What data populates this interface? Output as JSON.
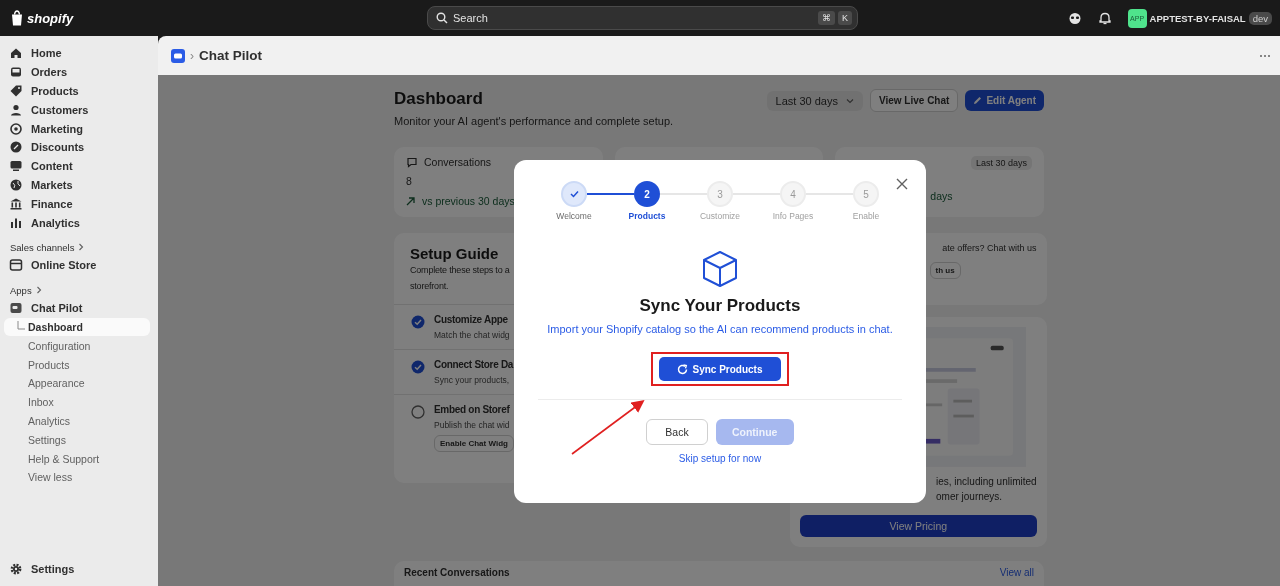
{
  "topbar": {
    "logo": "shopify",
    "search": {
      "placeholder": "Search",
      "keys": [
        "⌘",
        "K"
      ]
    },
    "store": {
      "avatar": "APP",
      "name": "APPTEST-BY-FAISAL",
      "badge": "dev"
    }
  },
  "sidebar": {
    "nav": [
      {
        "label": "Home",
        "selected": false
      },
      {
        "label": "Orders",
        "selected": false
      },
      {
        "label": "Products",
        "selected": false
      },
      {
        "label": "Customers",
        "selected": false
      },
      {
        "label": "Marketing",
        "selected": false
      },
      {
        "label": "Discounts",
        "selected": false
      },
      {
        "label": "Content",
        "selected": false
      },
      {
        "label": "Markets",
        "selected": false
      },
      {
        "label": "Finance",
        "selected": false
      },
      {
        "label": "Analytics",
        "selected": false
      }
    ],
    "sales_channels": {
      "heading": "Sales channels",
      "items": [
        {
          "label": "Online Store",
          "selected": false
        }
      ]
    },
    "apps": {
      "heading": "Apps",
      "items": [
        {
          "label": "Chat Pilot",
          "selected": false,
          "children": [
            {
              "label": "Dashboard",
              "selected": true
            },
            {
              "label": "Configuration",
              "selected": false
            },
            {
              "label": "Products",
              "selected": false
            },
            {
              "label": "Appearance",
              "selected": false
            },
            {
              "label": "Inbox",
              "selected": false
            },
            {
              "label": "Analytics",
              "selected": false
            },
            {
              "label": "Settings",
              "selected": false
            },
            {
              "label": "Help & Support",
              "selected": false
            },
            {
              "label": "View less",
              "selected": false
            }
          ]
        }
      ]
    },
    "footer": {
      "label": "Settings"
    }
  },
  "page_header": {
    "separator": "›",
    "breadcrumb": "Chat Pilot"
  },
  "dashboard": {
    "title": "Dashboard",
    "subtitle": "Monitor your AI agent's performance and complete setup.",
    "period": "Last 30 days",
    "buttons": [
      {
        "label": "View Live Chat",
        "kind": "secondary"
      },
      {
        "label": "Edit Agent",
        "kind": "primary"
      }
    ]
  },
  "stat_cards": [
    {
      "kind": "stat",
      "label": "Conversations",
      "value": "8",
      "trend": "vs previous 30 days"
    },
    {
      "kind": "stat"
    },
    {
      "kind": "stat",
      "period": "Last 30 days",
      "trend": "days"
    }
  ],
  "setup_guide": {
    "title": "Setup Guide",
    "description": [
      "Complete these steps to a",
      "storefront."
    ],
    "steps": [
      {
        "title": "Customize Appe",
        "text": "Match the chat widg",
        "done": true
      },
      {
        "title": "Connect Store Da",
        "text": "Sync your products,",
        "done": true
      },
      {
        "title": "Embed on Storef",
        "text": "Publish the chat wid",
        "done": false,
        "button": "Enable Chat Widg"
      }
    ]
  },
  "promo": {
    "text": "ate offers? Chat with us",
    "button": "th us"
  },
  "pricing": {
    "image": {
      "kind": "picture"
    },
    "lines": [
      "ies, including unlimited",
      "omer journeys."
    ],
    "button": "View Pricing"
  },
  "recent": {
    "title": "Recent Conversations",
    "link": "View all"
  },
  "modal": {
    "steps": [
      {
        "label": "Welcome",
        "done": true,
        "selected": false
      },
      {
        "number": "2",
        "label": "Products",
        "done": false,
        "selected": true
      },
      {
        "number": "3",
        "label": "Customize",
        "done": false,
        "selected": false
      },
      {
        "number": "4",
        "label": "Info Pages",
        "done": false,
        "selected": false
      },
      {
        "number": "5",
        "label": "Enable",
        "done": false,
        "selected": false
      }
    ],
    "title": "Sync Your Products",
    "description": "Import your Shopify catalog so the AI can recommend products in chat.",
    "action": "Sync Products",
    "action_highlighted": true,
    "buttons": [
      {
        "label": "Back",
        "kind": "secondary",
        "disabled": false
      },
      {
        "label": "Continue",
        "kind": "primary",
        "disabled": true
      }
    ],
    "skip": "Skip setup for now"
  }
}
